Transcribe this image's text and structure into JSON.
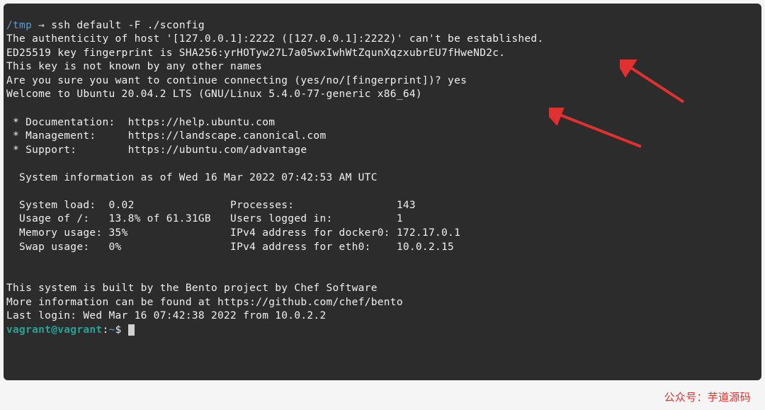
{
  "prompt": {
    "path": "/tmp",
    "sep": " → ",
    "command": "ssh default -F ./sconfig"
  },
  "lines": {
    "l1": "The authenticity of host '[127.0.0.1]:2222 ([127.0.0.1]:2222)' can't be established.",
    "l2": "ED25519 key fingerprint is SHA256:yrHOTyw27L7a05wxIwhWtZqunXqzxubrEU7fHweND2c.",
    "l3": "This key is not known by any other names",
    "l4": "Are you sure you want to continue connecting (yes/no/[fingerprint])? yes",
    "l5": "Welcome to Ubuntu 20.04.2 LTS (GNU/Linux 5.4.0-77-generic x86_64)",
    "l6": "",
    "l7": " * Documentation:  https://help.ubuntu.com",
    "l8": " * Management:     https://landscape.canonical.com",
    "l9": " * Support:        https://ubuntu.com/advantage",
    "l10": "",
    "l11": "  System information as of Wed 16 Mar 2022 07:42:53 AM UTC",
    "l12": "",
    "l13": "  System load:  0.02               Processes:                143",
    "l14": "  Usage of /:   13.8% of 61.31GB   Users logged in:          1",
    "l15": "  Memory usage: 35%                IPv4 address for docker0: 172.17.0.1",
    "l16": "  Swap usage:   0%                 IPv4 address for eth0:    10.0.2.15",
    "l17": "",
    "l18": "",
    "l19": "This system is built by the Bento project by Chef Software",
    "l20": "More information can be found at https://github.com/chef/bento",
    "l21": "Last login: Wed Mar 16 07:42:38 2022 from 10.0.2.2"
  },
  "shell_prompt": {
    "userhost": "vagrant@vagrant",
    "colon": ":",
    "cwd": "~",
    "dollar": "$ "
  },
  "watermark": "公众号：芋道源码"
}
